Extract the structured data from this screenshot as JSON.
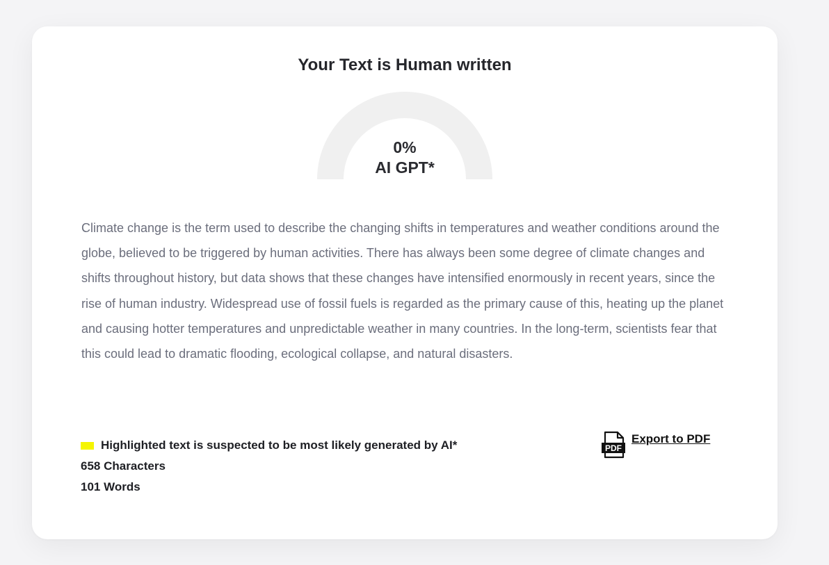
{
  "result": {
    "title": "Your Text is Human written",
    "gauge_percent_label": "0%",
    "gauge_label": "AI GPT*",
    "ai_fraction": 0
  },
  "analyzed_text": "Climate change is the term used to describe the changing shifts in temperatures and weather conditions around the globe, believed to be triggered by human activities. There has always been some degree of climate changes and shifts throughout history, but data shows that these changes have intensified enormously in recent years, since the rise of human industry. Widespread use of fossil fuels is regarded as the primary cause of this, heating up the planet and causing hotter temperatures and unpredictable weather in many countries. In the long-term, scientists fear that this could lead to dramatic flooding, ecological collapse, and natural disasters.",
  "legend": {
    "highlight_note": "Highlighted text is suspected to be most likely generated by AI*",
    "characters": "658 Characters",
    "words": "101 Words",
    "highlight_color": "#f5f500"
  },
  "export": {
    "label": "Export to PDF",
    "icon": "pdf-icon"
  },
  "colors": {
    "gauge_track": "#f0f0f0",
    "text": "#6b6e7c",
    "heading": "#25262b"
  }
}
